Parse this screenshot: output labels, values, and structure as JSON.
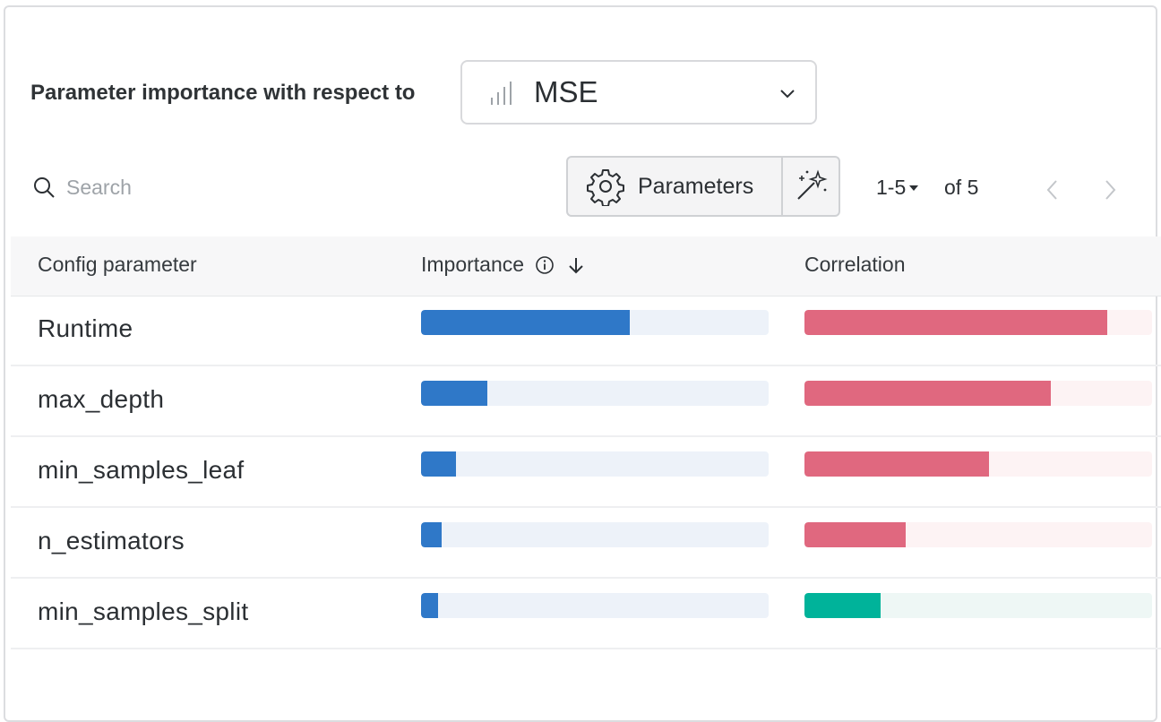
{
  "header": {
    "title": "Parameter importance with respect to",
    "metric_select": {
      "value": "MSE",
      "icon": "bar-chart-icon"
    }
  },
  "toolbar": {
    "search_placeholder": "Search",
    "parameters_label": "Parameters",
    "pager": {
      "range": "1-5",
      "of": "of 5"
    }
  },
  "table": {
    "columns": [
      "Config parameter",
      "Importance",
      "Correlation"
    ],
    "rows": [
      {
        "name": "Runtime",
        "importance": 0.6,
        "correlation": 0.87,
        "correlation_sign": "positive"
      },
      {
        "name": "max_depth",
        "importance": 0.19,
        "correlation": 0.71,
        "correlation_sign": "positive"
      },
      {
        "name": "min_samples_leaf",
        "importance": 0.1,
        "correlation": 0.53,
        "correlation_sign": "positive"
      },
      {
        "name": "n_estimators",
        "importance": 0.06,
        "correlation": 0.29,
        "correlation_sign": "positive"
      },
      {
        "name": "min_samples_split",
        "importance": 0.05,
        "correlation": 0.22,
        "correlation_sign": "negative"
      }
    ]
  },
  "colors": {
    "importance_bar": "#2f78c8",
    "importance_track": "#edf2f9",
    "positive_corr": "#e0687f",
    "positive_corr_track": "#fdf3f4",
    "negative_corr": "#00b39a",
    "negative_corr_track": "#eef7f5"
  }
}
